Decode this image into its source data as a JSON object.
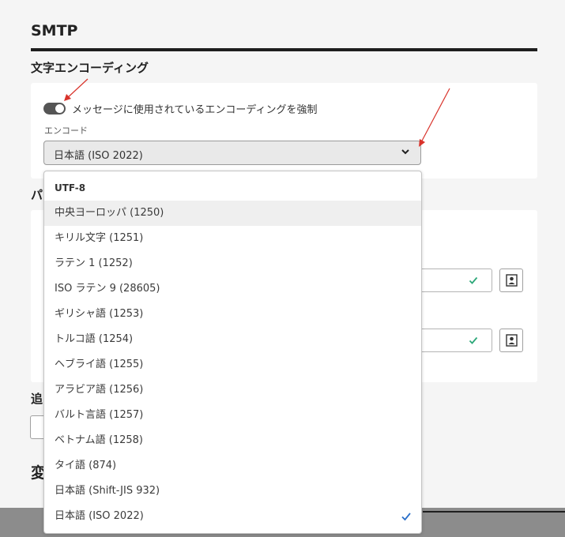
{
  "page": {
    "title": "SMTP"
  },
  "encoding_section": {
    "heading": "文字エンコーディング",
    "toggle_label": "メッセージに使用されているエンコーディングを強制",
    "toggle_on": true,
    "field_label": "エンコード",
    "selected_value": "日本語 (ISO 2022)"
  },
  "background": {
    "partial_heading_1": "パ",
    "partial_heading_2": "追",
    "partial_heading_3": "変"
  },
  "dropdown": {
    "options": [
      {
        "label": "UTF-8",
        "type": "header"
      },
      {
        "label": "中央ヨーロッパ (1250)",
        "state": "hover"
      },
      {
        "label": "キリル文字 (1251)"
      },
      {
        "label": "ラテン 1 (1252)"
      },
      {
        "label": "ISO ラテン 9 (28605)"
      },
      {
        "label": "ギリシャ語 (1253)"
      },
      {
        "label": "トルコ語 (1254)"
      },
      {
        "label": "ヘブライ語 (1255)"
      },
      {
        "label": "アラビア語 (1256)"
      },
      {
        "label": "バルト言語 (1257)"
      },
      {
        "label": "ベトナム語 (1258)"
      },
      {
        "label": "タイ語 (874)"
      },
      {
        "label": "日本語 (Shift-JIS 932)"
      },
      {
        "label": "日本語 (ISO 2022)",
        "state": "selected"
      }
    ]
  },
  "colors": {
    "annotation_arrow": "#d9332b",
    "check_selected": "#2a6fc9",
    "check_valid": "#2ea87a"
  }
}
